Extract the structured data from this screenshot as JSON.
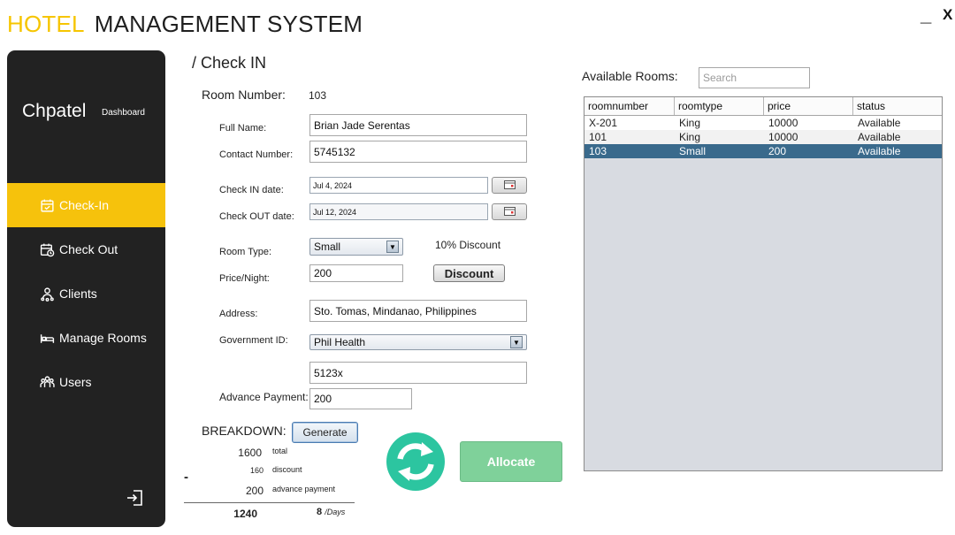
{
  "header": {
    "title_accent": "HOTEL",
    "title_rest": "MANAGEMENT SYSTEM",
    "minimize": "_",
    "close": "X"
  },
  "colors": {
    "accent": "#f6c20c",
    "sidebar": "#222222",
    "allocate": "#7fd19a",
    "selected_row": "#3a6a8c",
    "refresh": "#2cc5a0"
  },
  "sidebar": {
    "brand": "Chpatel",
    "brand_sub": "Dashboard",
    "items": [
      {
        "label": "Check-In",
        "icon": "calendar-check-icon",
        "active": true
      },
      {
        "label": "Check Out",
        "icon": "calendar-clock-icon",
        "active": false
      },
      {
        "label": "Clients",
        "icon": "clients-icon",
        "active": false
      },
      {
        "label": "Manage Rooms",
        "icon": "bed-icon",
        "active": false
      },
      {
        "label": "Users",
        "icon": "users-icon",
        "active": false
      }
    ],
    "logout_icon": "logout-icon"
  },
  "form": {
    "breadcrumb": "/ Check IN",
    "room_number_label": "Room Number:",
    "room_number": "103",
    "full_name_label": "Full Name:",
    "full_name": "Brian Jade Serentas",
    "contact_label": "Contact Number:",
    "contact": "5745132",
    "checkin_label": "Check IN date:",
    "checkin": "Jul 4, 2024",
    "checkout_label": "Check OUT date:",
    "checkout": "Jul 12, 2024",
    "room_type_label": "Room Type:",
    "room_type": "Small",
    "discount_text": "10% Discount",
    "price_label": "Price/Night:",
    "price": "200",
    "discount_button": "Discount",
    "address_label": "Address:",
    "address": "Sto. Tomas, Mindanao, Philippines",
    "gov_id_label": "Government ID:",
    "gov_id_type": "Phil Health",
    "gov_id_number": "5123x",
    "advance_label": "Advance Payment:",
    "advance": "200"
  },
  "breakdown": {
    "label": "BREAKDOWN:",
    "generate_button": "Generate",
    "total": "1600",
    "total_label": "total",
    "discount": "160",
    "discount_label": "discount",
    "minus": "-",
    "advance": "200",
    "advance_label": "advance payment",
    "result": "1240",
    "days": "8",
    "days_label": "/Days"
  },
  "actions": {
    "allocate": "Allocate",
    "refresh_icon": "refresh-icon"
  },
  "rooms": {
    "label": "Available Rooms:",
    "search_placeholder": "Search",
    "columns": [
      "roomnumber",
      "roomtype",
      "price",
      "status"
    ],
    "rows": [
      [
        "X-201",
        "King",
        "10000",
        "Available"
      ],
      [
        "101",
        "King",
        "10000",
        "Available"
      ],
      [
        "103",
        "Small",
        "200",
        "Available"
      ]
    ],
    "selected_row": 2
  }
}
